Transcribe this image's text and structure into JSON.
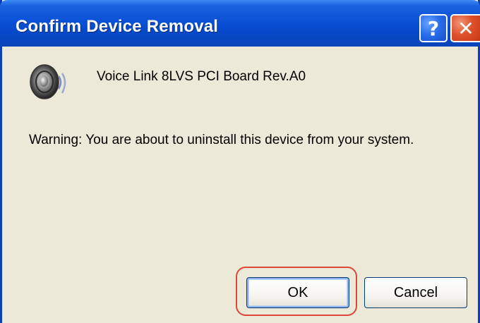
{
  "dialog": {
    "title": "Confirm Device Removal",
    "help_glyph": "?",
    "close_glyph": "✕",
    "device_name": "Voice Link 8LVS PCI Board Rev.A0",
    "device_icon": "speaker-icon",
    "warning": "Warning: You are about to uninstall this device from your system.",
    "ok_label": "OK",
    "cancel_label": "Cancel"
  },
  "colors": {
    "titlebar": "#0a51d6",
    "dialog_bg": "#ece9d8",
    "close_button": "#e0512a",
    "highlight": "#e0453a"
  }
}
